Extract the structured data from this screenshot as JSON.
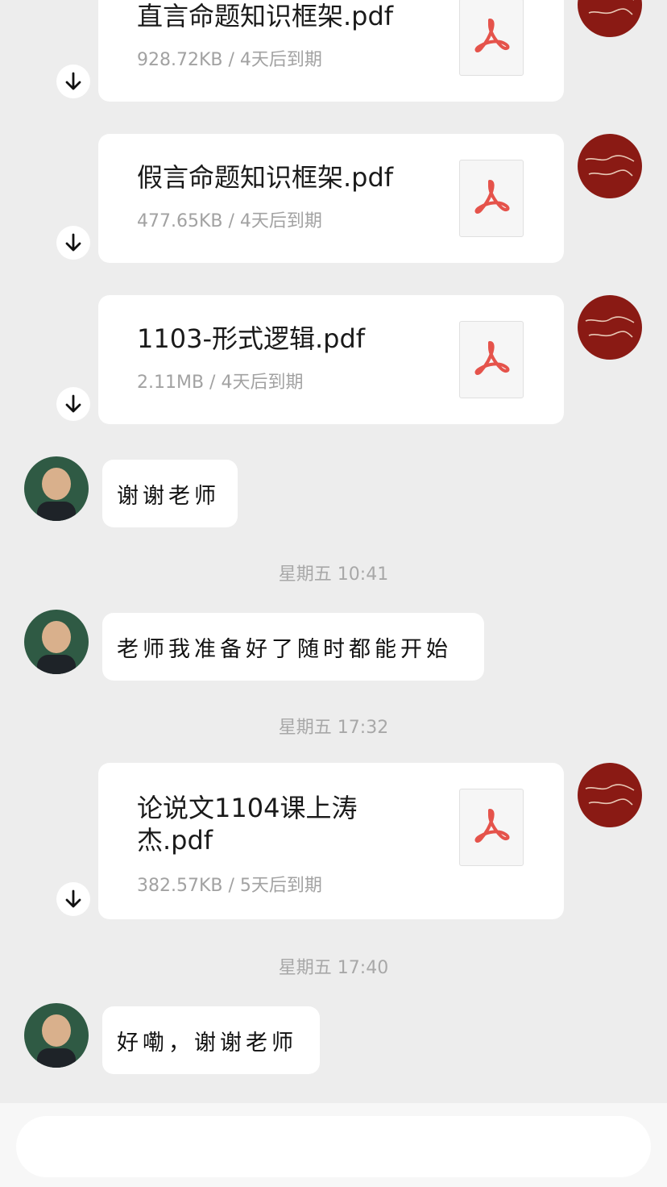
{
  "files": [
    {
      "name": "直言命题知识框架.pdf",
      "meta": "928.72KB / 4天后到期"
    },
    {
      "name": "假言命题知识框架.pdf",
      "meta": "477.65KB / 4天后到期"
    },
    {
      "name": "1103-形式逻辑.pdf",
      "meta": "2.11MB / 4天后到期"
    },
    {
      "name": "论说文1104课上涛杰.pdf",
      "meta": "382.57KB / 5天后到期"
    }
  ],
  "messages": [
    {
      "text": "谢谢老师"
    },
    {
      "text": "老师我准备好了随时都能开始"
    },
    {
      "text": "好嘞，谢谢老师"
    }
  ],
  "timestamps": [
    "星期五 10:41",
    "星期五 17:32",
    "星期五 17:40"
  ],
  "icons": {
    "pdf": "pdf-file-icon",
    "download": "arrow-down-icon"
  },
  "colors": {
    "background": "#ededed",
    "card": "#ffffff",
    "pdf_red": "#e5534b",
    "teacher_avatar": "#8a1a14",
    "student_avatar": "#2f5a44"
  },
  "input": {
    "placeholder": ""
  }
}
